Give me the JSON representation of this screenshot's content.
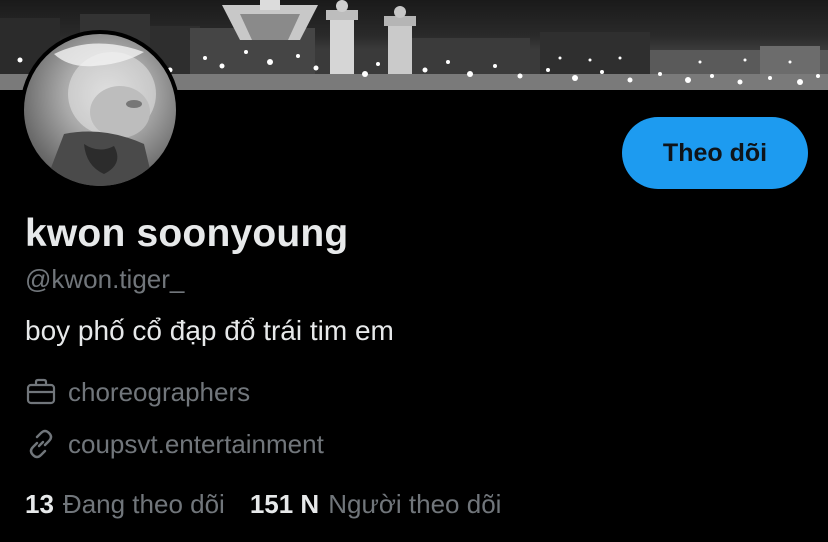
{
  "profile": {
    "display_name": "kwon soonyoung",
    "handle": "@kwon.tiger_",
    "bio": "boy phố cổ đạp đổ trái tim em",
    "category": "choreographers",
    "website": "coupsvt.entertainment"
  },
  "actions": {
    "follow_label": "Theo dõi"
  },
  "stats": {
    "following_count": "13",
    "following_label": "Đang theo dõi",
    "followers_count": "151 N",
    "followers_label": "Người theo dõi"
  },
  "colors": {
    "accent": "#1d9bf0",
    "text_primary": "#e7e9ea",
    "text_secondary": "#71767b",
    "background": "#000000"
  },
  "icons": {
    "category": "briefcase-icon",
    "website": "link-icon"
  }
}
